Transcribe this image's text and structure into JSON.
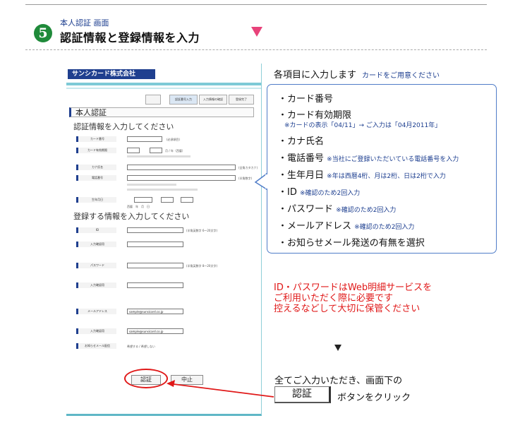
{
  "header": {
    "step_number": "5",
    "step_subtitle": "本人認証 画面",
    "step_title": "認証情報と登録情報を入力"
  },
  "mock_screen": {
    "brand": "サンシカード株式会社",
    "crumbs": [
      "認証番号入力",
      "入力情報の確認",
      "登録完了"
    ],
    "section_title": "本人認証",
    "auth_heading": "認証情報を入力してください",
    "auth_fields": [
      {
        "label": "カード番号",
        "note": "(必須項目)"
      },
      {
        "label": "カード有効期限",
        "note": "月 / 年（西暦）"
      },
      {
        "label": "カナ氏名",
        "note": "(全角カタカナ)"
      },
      {
        "label": "電話番号",
        "note": "(半角数字)"
      },
      {
        "label": "生年月日",
        "note": "西暦　年　月　日"
      }
    ],
    "reg_heading": "登録する情報を入力してください",
    "reg_fields": [
      {
        "label": "ID",
        "note": "(半角英数字 6〜20文字)"
      },
      {
        "label": "入力確認用",
        "note": ""
      },
      {
        "label": "パスワード",
        "note": "(半角英数字 8〜20文字)"
      },
      {
        "label": "入力確認用",
        "note": ""
      },
      {
        "label": "メールアドレス",
        "note": "sample@sunsicard.co.jp"
      },
      {
        "label": "入力確認用",
        "note": "sample@sunsicard.co.jp"
      },
      {
        "label": "お知らせメール配信",
        "note": "希望する / 希望しない"
      }
    ],
    "submit_label": "認証",
    "cancel_label": "中止"
  },
  "right": {
    "intro": "各項目に入力します",
    "intro_note": "カードをご用意ください",
    "items": [
      {
        "text": "・カード番号",
        "note": ""
      },
      {
        "text": "・カード有効期限",
        "note": ""
      },
      {
        "text": "・カナ氏名",
        "note": ""
      },
      {
        "text": "・電話番号",
        "note": "※当社にご登録いただいている電話番号を入力"
      },
      {
        "text": "・生年月日",
        "note": "※年は西暦4桁、月は2桁、日は2桁で入力"
      },
      {
        "text": "・ID",
        "note": "※確認のため2回入力"
      },
      {
        "text": "・パスワード",
        "note": "※確認のため2回入力"
      },
      {
        "text": "・メールアドレス",
        "note": "※確認のため2回入力"
      },
      {
        "text": "・お知らせメール発送の有無を選択",
        "note": ""
      }
    ],
    "expiry_sub": "※カードの表示「04/11」→ ご入力は「04月2011年」",
    "warning": [
      "ID・パスワードはWeb明細サービスを",
      "ご利用いただく際に必要です",
      "控えるなどして大切に保管ください"
    ],
    "final_line1": "全てご入力いただき、画面下の",
    "final_button": "認証",
    "final_line2": "ボタンをクリック"
  },
  "colors": {
    "accent_green": "#1f8a3a",
    "brand_navy": "#1f3f8f",
    "highlight_red": "#e01818",
    "pink_arrow": "#e8427a",
    "callout_blue": "#4f7cc8"
  }
}
